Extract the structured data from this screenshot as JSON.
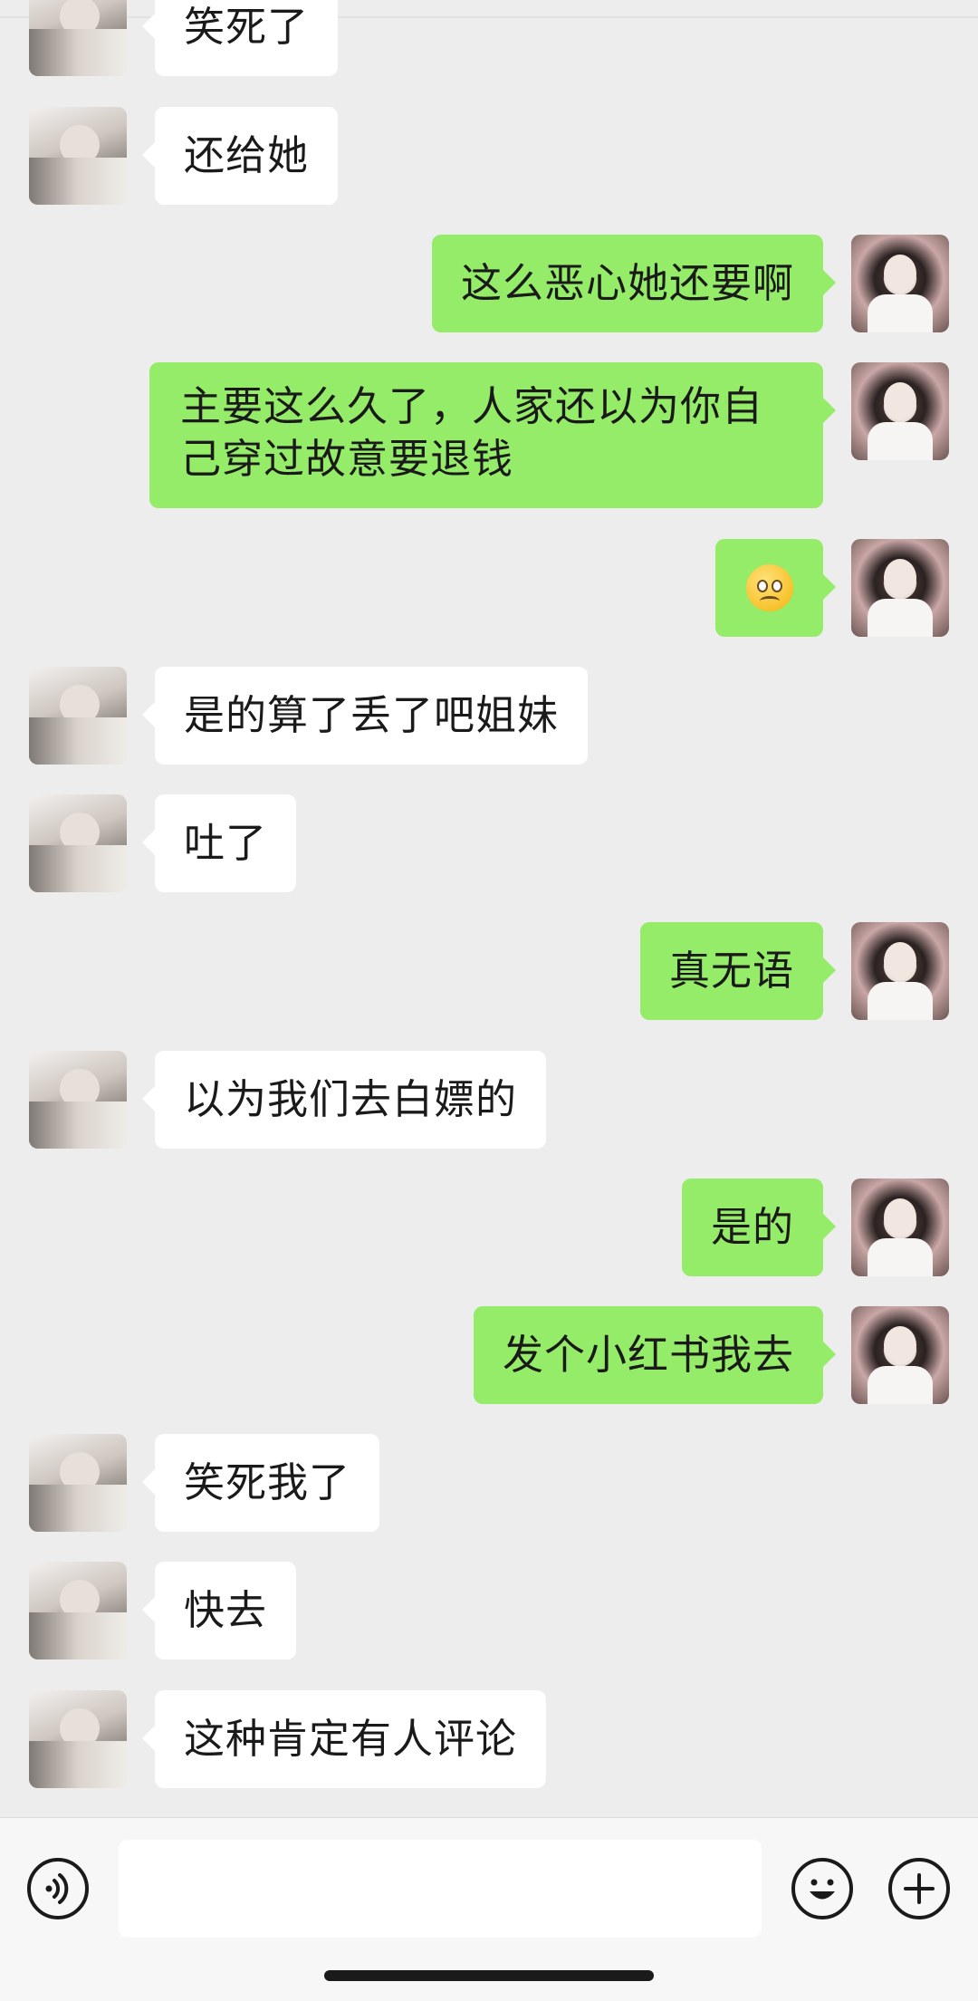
{
  "messages": [
    {
      "side": "left",
      "text": "笑死了"
    },
    {
      "side": "left",
      "text": "还给她"
    },
    {
      "side": "right",
      "text": "这么恶心她还要啊"
    },
    {
      "side": "right",
      "text": "主要这么久了，人家还以为你自己穿过故意要退钱"
    },
    {
      "side": "right",
      "text": "",
      "emoji": "pleading-face"
    },
    {
      "side": "left",
      "text": "是的算了丢了吧姐妹"
    },
    {
      "side": "left",
      "text": "吐了"
    },
    {
      "side": "right",
      "text": "真无语"
    },
    {
      "side": "left",
      "text": "以为我们去白嫖的"
    },
    {
      "side": "right",
      "text": "是的"
    },
    {
      "side": "right",
      "text": "发个小红书我去"
    },
    {
      "side": "left",
      "text": "笑死我了"
    },
    {
      "side": "left",
      "text": "快去"
    },
    {
      "side": "left",
      "text": "这种肯定有人评论"
    }
  ],
  "input": {
    "value": "",
    "icons": {
      "voice": "voice-icon",
      "emoji": "emoji-icon",
      "plus": "plus-icon"
    }
  },
  "colors": {
    "sent_bubble": "#95ec69",
    "received_bubble": "#ffffff",
    "background": "#ededed"
  }
}
